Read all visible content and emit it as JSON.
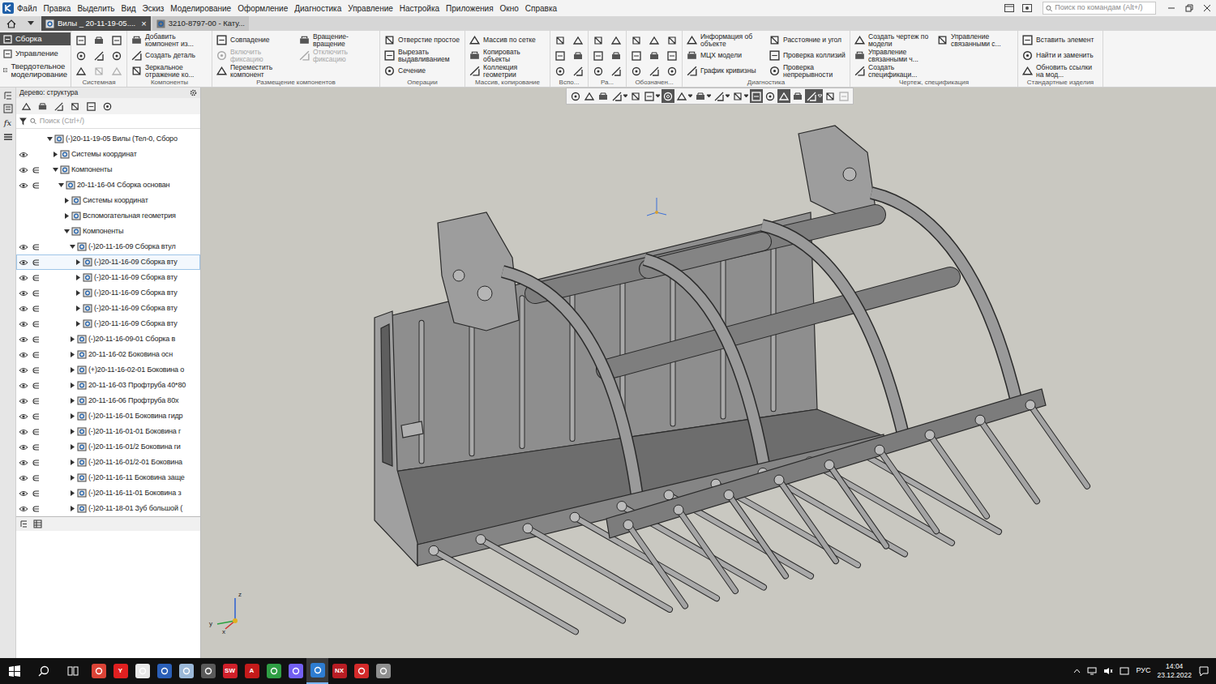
{
  "menu": [
    "Файл",
    "Правка",
    "Выделить",
    "Вид",
    "Эскиз",
    "Моделирование",
    "Оформление",
    "Диагностика",
    "Управление",
    "Настройка",
    "Приложения",
    "Окно",
    "Справка"
  ],
  "command_search": {
    "placeholder": "Поиск по командам (Alt+/)"
  },
  "tabs": [
    {
      "label": "Вилы _ 20-11-19-05....",
      "selected": true,
      "close": "×"
    },
    {
      "label": "3210-8797-00 - Кату...",
      "selected": false
    }
  ],
  "ribbon": {
    "modes": [
      {
        "label": "Сборка",
        "selected": true
      },
      {
        "label": "Управление",
        "selected": false
      },
      {
        "label": "Твердотельное моделирование",
        "selected": false
      }
    ],
    "groups": [
      {
        "label": "Системная",
        "buttons": [
          {
            "kind": "icon",
            "disabled": false
          },
          {
            "kind": "icon",
            "disabled": false
          },
          {
            "kind": "icon",
            "disabled": false
          },
          {
            "kind": "icon",
            "disabled": false
          },
          {
            "kind": "icon",
            "disabled": false
          },
          {
            "kind": "icon",
            "disabled": true
          },
          {
            "kind": "icon",
            "disabled": false
          },
          {
            "kind": "icon",
            "disabled": false
          },
          {
            "kind": "icon",
            "disabled": true
          }
        ]
      },
      {
        "label": "Компоненты",
        "buttons": [
          {
            "kind": "text",
            "label": "Добавить компонент из...",
            "disabled": false
          },
          {
            "kind": "text",
            "label": "Создать деталь",
            "disabled": false
          },
          {
            "kind": "text",
            "label": "Зеркальное отражение ко...",
            "disabled": false
          }
        ]
      },
      {
        "label": "Размещение компонентов",
        "buttons": [
          {
            "kind": "text",
            "label": "Совпадение",
            "disabled": false
          },
          {
            "kind": "text",
            "label": "Включить фиксацию",
            "disabled": true
          },
          {
            "kind": "text",
            "label": "Переместить компонент",
            "disabled": false
          },
          {
            "kind": "text",
            "label": "Вращение-вращение",
            "disabled": false
          },
          {
            "kind": "text",
            "label": "Отключить фиксацию",
            "disabled": true
          }
        ]
      },
      {
        "label": "Операции",
        "buttons": [
          {
            "kind": "text",
            "label": "Отверстие простое",
            "disabled": false
          },
          {
            "kind": "text",
            "label": "Вырезать выдавливанием",
            "disabled": false
          },
          {
            "kind": "text",
            "label": "Сечение",
            "disabled": false
          }
        ]
      },
      {
        "label": "Массив, копирование",
        "buttons": [
          {
            "kind": "text",
            "label": "Массив по сетке",
            "disabled": false
          },
          {
            "kind": "text",
            "label": "Копировать объекты",
            "disabled": false
          },
          {
            "kind": "text",
            "label": "Коллекция геометрии",
            "disabled": false
          }
        ]
      },
      {
        "label": "Вспо...",
        "buttons": [
          {
            "kind": "icon",
            "disabled": false
          },
          {
            "kind": "icon",
            "disabled": false
          },
          {
            "kind": "icon",
            "disabled": false
          },
          {
            "kind": "icon",
            "disabled": false
          },
          {
            "kind": "icon",
            "disabled": false
          },
          {
            "kind": "icon",
            "disabled": false
          }
        ]
      },
      {
        "label": "Ра...",
        "buttons": [
          {
            "kind": "icon",
            "disabled": false
          },
          {
            "kind": "icon",
            "disabled": false
          },
          {
            "kind": "icon",
            "disabled": false
          },
          {
            "kind": "icon",
            "disabled": false
          },
          {
            "kind": "icon",
            "disabled": false
          },
          {
            "kind": "icon",
            "disabled": false
          }
        ]
      },
      {
        "label": "Обозначен...",
        "buttons": [
          {
            "kind": "icon",
            "disabled": false
          },
          {
            "kind": "icon",
            "disabled": false
          },
          {
            "kind": "icon",
            "disabled": false
          },
          {
            "kind": "icon",
            "disabled": false
          },
          {
            "kind": "icon",
            "disabled": false
          },
          {
            "kind": "icon",
            "disabled": false
          },
          {
            "kind": "icon",
            "disabled": false
          },
          {
            "kind": "icon",
            "disabled": false
          },
          {
            "kind": "icon",
            "disabled": false
          }
        ]
      },
      {
        "label": "Диагностика",
        "buttons": [
          {
            "kind": "text",
            "label": "Информация об объекте",
            "disabled": false
          },
          {
            "kind": "text",
            "label": "МЦХ модели",
            "disabled": false
          },
          {
            "kind": "text",
            "label": "График кривизны",
            "disabled": false
          },
          {
            "kind": "text",
            "label": "Расстояние и угол",
            "disabled": false
          },
          {
            "kind": "text",
            "label": "Проверка коллизий",
            "disabled": false
          },
          {
            "kind": "text",
            "label": "Проверка непрерывности",
            "disabled": false
          }
        ]
      },
      {
        "label": "Чертеж, спецификация",
        "buttons": [
          {
            "kind": "text",
            "label": "Создать чертеж по модели",
            "disabled": false
          },
          {
            "kind": "text",
            "label": "Управление связанными ч...",
            "disabled": false
          },
          {
            "kind": "text",
            "label": "Создать спецификаци...",
            "disabled": false
          },
          {
            "kind": "text",
            "label": "Управление связанными с...",
            "disabled": false
          }
        ]
      },
      {
        "label": "Стандартные изделия",
        "buttons": [
          {
            "kind": "text",
            "label": "Вставить элемент",
            "disabled": false
          },
          {
            "kind": "text",
            "label": "Найти и заменить",
            "disabled": false
          },
          {
            "kind": "text",
            "label": "Обновить ссылки на мод...",
            "disabled": false
          }
        ]
      }
    ]
  },
  "side_strip": {
    "formula": "fx"
  },
  "tree": {
    "title": "Дерево: структура",
    "search_placeholder": "Поиск (Ctrl+/)",
    "items": [
      {
        "label": "(-)20-11-19-05 Вилы (Тел-0, Сборо",
        "level": 0,
        "expanded": true,
        "eye": false,
        "include": false,
        "selected": false
      },
      {
        "label": "Системы координат",
        "level": 1,
        "expanded": false,
        "eye": true,
        "include": false,
        "selected": false
      },
      {
        "label": "Компоненты",
        "level": 1,
        "expanded": true,
        "eye": true,
        "include": true,
        "selected": false
      },
      {
        "label": "20-11-16-04 Сборка основан",
        "level": 2,
        "expanded": true,
        "eye": true,
        "include": true,
        "selected": false
      },
      {
        "label": "Системы координат",
        "level": 3,
        "expanded": false,
        "eye": false,
        "include": false,
        "selected": false
      },
      {
        "label": "Вспомогательная геометрия",
        "level": 3,
        "expanded": false,
        "eye": false,
        "include": false,
        "selected": false
      },
      {
        "label": "Компоненты",
        "level": 3,
        "expanded": true,
        "eye": false,
        "include": false,
        "selected": false
      },
      {
        "label": "(-)20-11-16-09 Сборка втул",
        "level": 4,
        "expanded": true,
        "eye": true,
        "include": true,
        "selected": false
      },
      {
        "label": "(-)20-11-16-09 Сборка вту",
        "level": 5,
        "expanded": false,
        "eye": true,
        "include": true,
        "selected": true
      },
      {
        "label": "(-)20-11-16-09 Сборка вту",
        "level": 5,
        "expanded": false,
        "eye": true,
        "include": true,
        "selected": false
      },
      {
        "label": "(-)20-11-16-09 Сборка вту",
        "level": 5,
        "expanded": false,
        "eye": true,
        "include": true,
        "selected": false
      },
      {
        "label": "(-)20-11-16-09 Сборка вту",
        "level": 5,
        "expanded": false,
        "eye": true,
        "include": true,
        "selected": false
      },
      {
        "label": "(-)20-11-16-09 Сборка вту",
        "level": 5,
        "expanded": false,
        "eye": true,
        "include": true,
        "selected": false
      },
      {
        "label": "(-)20-11-16-09-01 Сборка в",
        "level": 4,
        "expanded": false,
        "eye": true,
        "include": true,
        "selected": false
      },
      {
        "label": "20-11-16-02 Боковина осн",
        "level": 4,
        "expanded": false,
        "eye": true,
        "include": true,
        "selected": false
      },
      {
        "label": "(+)20-11-16-02-01 Боковина о",
        "level": 4,
        "expanded": false,
        "eye": true,
        "include": true,
        "selected": false
      },
      {
        "label": "20-11-16-03 Профтруба 40*80",
        "level": 4,
        "expanded": false,
        "eye": true,
        "include": true,
        "selected": false
      },
      {
        "label": "20-11-16-06 Профтруба 80х",
        "level": 4,
        "expanded": false,
        "eye": true,
        "include": true,
        "selected": false
      },
      {
        "label": "(-)20-11-16-01 Боковина гидр",
        "level": 4,
        "expanded": false,
        "eye": true,
        "include": true,
        "selected": false
      },
      {
        "label": "(-)20-11-16-01-01 Боковина г",
        "level": 4,
        "expanded": false,
        "eye": true,
        "include": true,
        "selected": false
      },
      {
        "label": "(-)20-11-16-01/2 Боковина ги",
        "level": 4,
        "expanded": false,
        "eye": true,
        "include": true,
        "selected": false
      },
      {
        "label": "(-)20-11-16-01/2-01 Боковина",
        "level": 4,
        "expanded": false,
        "eye": true,
        "include": true,
        "selected": false
      },
      {
        "label": "(-)20-11-16-11 Боковина заще",
        "level": 4,
        "expanded": false,
        "eye": true,
        "include": true,
        "selected": false
      },
      {
        "label": "(-)20-11-16-11-01 Боковина з",
        "level": 4,
        "expanded": false,
        "eye": true,
        "include": true,
        "selected": false
      },
      {
        "label": "(-)20-11-18-01 Зуб большой (",
        "level": 4,
        "expanded": false,
        "eye": true,
        "include": true,
        "selected": false
      }
    ]
  },
  "view_toolbar": [
    {
      "kind": "button",
      "selected": false,
      "disabled": false
    },
    {
      "kind": "button",
      "selected": false,
      "disabled": false
    },
    {
      "kind": "button",
      "selected": false,
      "disabled": false
    },
    {
      "kind": "dropdown",
      "selected": false,
      "disabled": false
    },
    {
      "kind": "button",
      "selected": false,
      "disabled": false
    },
    {
      "kind": "dropdown",
      "selected": false,
      "disabled": false
    },
    {
      "kind": "button",
      "selected": true,
      "disabled": false
    },
    {
      "kind": "dropdown",
      "selected": false,
      "disabled": false
    },
    {
      "kind": "dropdown",
      "selected": false,
      "disabled": false
    },
    {
      "kind": "dropdown",
      "selected": false,
      "disabled": false
    },
    {
      "kind": "dropdown",
      "selected": false,
      "disabled": false
    },
    {
      "kind": "button",
      "selected": true,
      "disabled": false
    },
    {
      "kind": "button",
      "selected": false,
      "disabled": false
    },
    {
      "kind": "button",
      "selected": true,
      "disabled": false
    },
    {
      "kind": "button",
      "selected": false,
      "disabled": false
    },
    {
      "kind": "dropdown",
      "selected": true,
      "disabled": false
    },
    {
      "kind": "button",
      "selected": false,
      "disabled": false
    },
    {
      "kind": "button",
      "selected": false,
      "disabled": true
    }
  ],
  "axes": {
    "x": "x",
    "y": "y",
    "z": "z"
  },
  "taskbar": {
    "apps": [
      {
        "kind": "logo",
        "color": "#db4437",
        "active": false
      },
      {
        "kind": "glyph",
        "label": "Y",
        "color": "#e02020",
        "active": false
      },
      {
        "kind": "logo",
        "color": "#e8e8e8",
        "active": false
      },
      {
        "kind": "logo",
        "color": "#2a5fb8",
        "active": false
      },
      {
        "kind": "logo",
        "color": "#9bb8d8",
        "active": false
      },
      {
        "kind": "logo",
        "color": "#5a5a5a",
        "active": false
      },
      {
        "kind": "glyph",
        "label": "SW",
        "color": "#d0202a",
        "active": false
      },
      {
        "kind": "glyph",
        "label": "A",
        "color": "#c41a1a",
        "active": false
      },
      {
        "kind": "logo",
        "color": "#2f9e44",
        "active": false
      },
      {
        "kind": "logo",
        "color": "#7360f2",
        "active": false
      },
      {
        "kind": "logo",
        "color": "#2e7dd1",
        "active": true
      },
      {
        "kind": "glyph",
        "label": "NX",
        "color": "#b81d24",
        "active": false
      },
      {
        "kind": "logo",
        "color": "#d42a2a",
        "active": false
      },
      {
        "kind": "logo",
        "color": "#8f8f8f",
        "active": false
      }
    ],
    "lang": "РУС",
    "time": "14:04",
    "date": "23.12.2022"
  }
}
